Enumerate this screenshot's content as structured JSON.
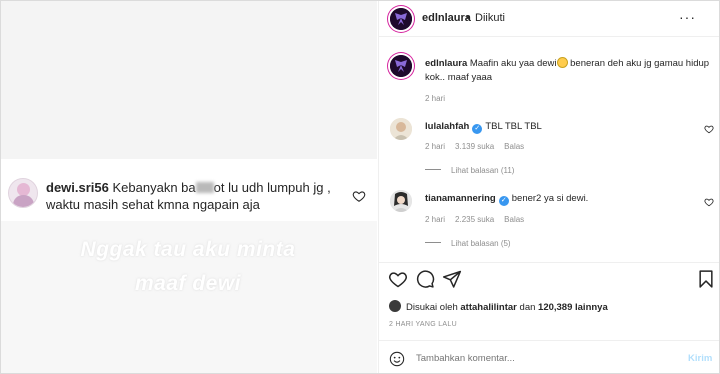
{
  "media": {
    "overlay_comment": {
      "username": "dewi.sri56",
      "text_before": "Kebanyakn ba",
      "text_after": "ot lu udh lumpuh jg ,",
      "line2": "waktu masih sehat kmna ngapain aja"
    },
    "caption_line1": "Nggak tau aku minta",
    "caption_line2": "maaf dewi"
  },
  "header": {
    "username": "edlnlaura",
    "dot": "•",
    "follow_status": "Diikuti",
    "more": "···"
  },
  "post_caption": {
    "username": "edlnlaura",
    "text_part1": "Maafin aku yaa dewi",
    "text_part2": " beneran deh aku jg gamau hidup kok.. maaf yaaa",
    "time": "2 hari"
  },
  "comments": [
    {
      "username": "lulalahfah",
      "text": "TBL TBL TBL",
      "time": "2 hari",
      "likes": "3.139 suka",
      "reply": "Balas",
      "view_replies": "Lihat balasan (11)"
    },
    {
      "username": "tianamannering",
      "text": "bener2 ya si dewi.",
      "time": "2 hari",
      "likes": "2.235 suka",
      "reply": "Balas",
      "view_replies": "Lihat balasan (5)"
    }
  ],
  "likes_line": {
    "prefix": "Disukai oleh",
    "user": "attahalilintar",
    "middle": "dan",
    "count": "120,389 lainnya"
  },
  "time_ago": "2 HARI YANG LALU",
  "comment_box": {
    "placeholder": "Tambahkan komentar...",
    "post_label": "Kirim"
  },
  "colors": {
    "verified": "#3897f0",
    "post_disabled": "#b2dffc",
    "secondary_text": "#8e8e8e"
  }
}
